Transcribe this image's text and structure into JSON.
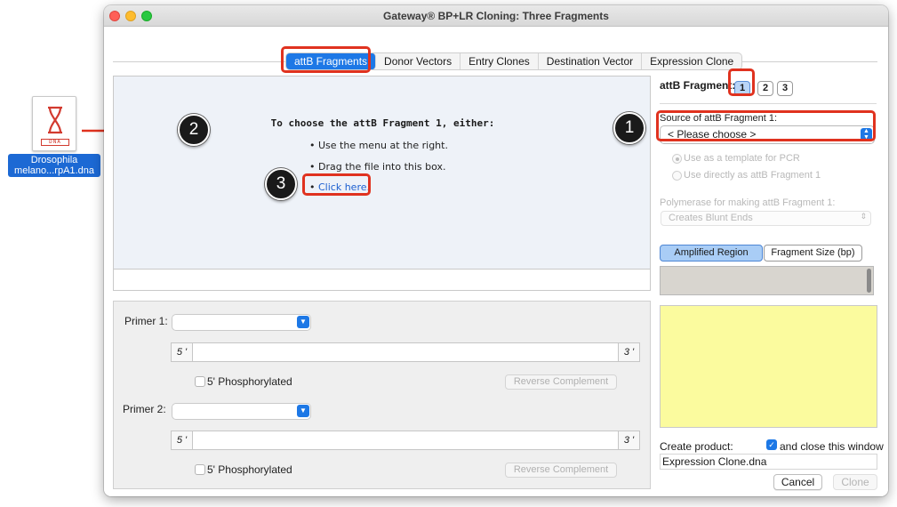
{
  "window": {
    "title": "Gateway® BP+LR Cloning: Three Fragments"
  },
  "desktop_file": {
    "badge": "DNA",
    "label_line1": "Drosophila",
    "label_line2": "melano...rpA1.dna"
  },
  "tabs": [
    {
      "label": "attB Fragments",
      "active": true
    },
    {
      "label": "Donor Vectors"
    },
    {
      "label": "Entry Clones"
    },
    {
      "label": "Destination Vector"
    },
    {
      "label": "Expression Clone"
    }
  ],
  "drop_area": {
    "title": "To choose the attB Fragment 1, either:",
    "item1": "Use the menu at the right.",
    "item2": "Drag the file into this box.",
    "link": "Click here."
  },
  "primers": {
    "primer1_label": "Primer 1:",
    "primer2_label": "Primer 2:",
    "five_prime": "5 '",
    "three_prime": "3 '",
    "phos_label": "5' Phosphorylated",
    "revcomp_label": "Reverse Complement"
  },
  "fragment": {
    "label": "attB Fragment:",
    "buttons": [
      "1",
      "2",
      "3"
    ],
    "selected": "1",
    "source_label": "Source of attB Fragment 1:",
    "source_value": "< Please choose >",
    "radio1": "Use as a template for PCR",
    "radio2": "Use directly as attB Fragment 1",
    "polymerase_label": "Polymerase for making attB Fragment 1:",
    "polymerase_value": "Creates Blunt Ends",
    "seg_amplified": "Amplified Region",
    "seg_size": "Fragment Size (bp)"
  },
  "product": {
    "create_label": "Create product:",
    "close_label": "and close this window",
    "close_checked": true,
    "name": "Expression Clone.dna",
    "cancel_label": "Cancel",
    "clone_label": "Clone"
  },
  "callouts": [
    "1",
    "2",
    "3"
  ],
  "colors": {
    "accent": "#1d78e6",
    "highlight": "#e0321f",
    "yellow_area": "#fbfb9e"
  }
}
